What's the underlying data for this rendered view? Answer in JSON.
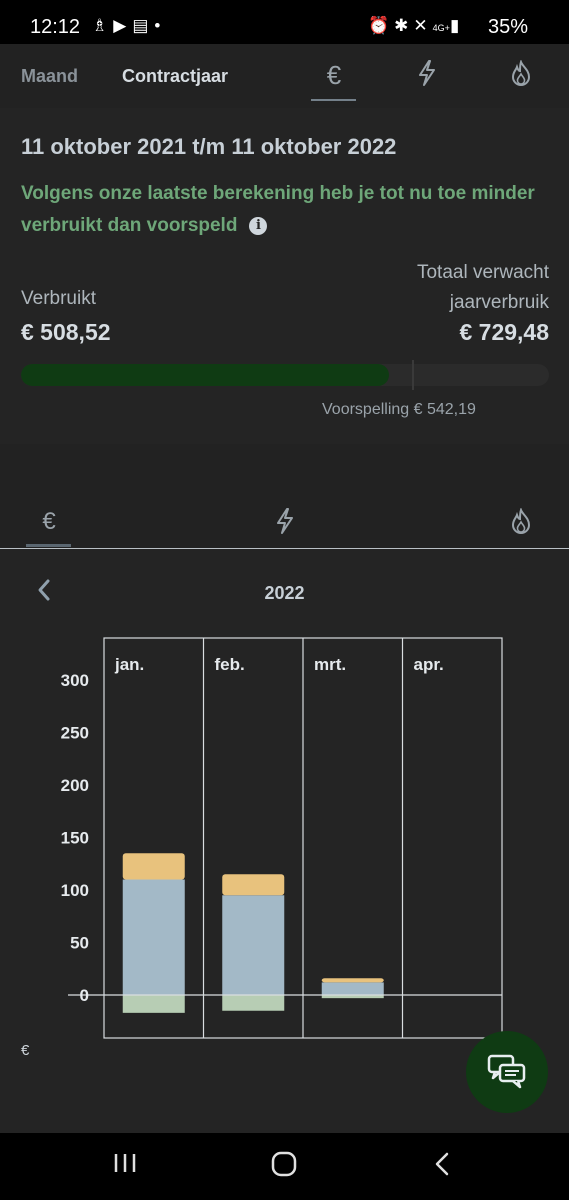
{
  "status_bar": {
    "time": "12:12",
    "left_icons": [
      "notification-icon",
      "youtube-icon",
      "news-icon",
      "dot-icon"
    ],
    "right_icons": [
      "alarm-icon",
      "bluetooth-icon",
      "mute-icon",
      "signal-icon"
    ],
    "network": "4G+",
    "battery": "35%"
  },
  "top_tabs": {
    "month": "Maand",
    "contract_year": "Contractjaar",
    "icons": [
      "euro-icon",
      "lightning-icon",
      "flame-icon"
    ]
  },
  "summary": {
    "period": "11 oktober 2021 t/m 11 oktober 2022",
    "message": "Volgens onze laatste berekening heb je tot nu toe minder verbruikt dan voorspeld",
    "used_label": "Verbruikt",
    "used_value": "€ 508,52",
    "expected_label_line1": "Totaal verwacht",
    "expected_label_line2": "jaarverbruik",
    "expected_value": "€ 729,48",
    "progress_fraction": 0.697,
    "forecast_fraction": 0.743,
    "forecast_text": "Voorspelling € 542,19"
  },
  "chart_tabs": {
    "icons": [
      "euro-icon",
      "lightning-icon",
      "flame-icon"
    ]
  },
  "chart_header": {
    "year": "2022"
  },
  "chart_data": {
    "type": "bar",
    "stacked": true,
    "categories": [
      "jan.",
      "feb.",
      "mrt.",
      "apr."
    ],
    "ylabel": "€",
    "ylim": [
      -20,
      330
    ],
    "yticks": [
      0,
      50,
      100,
      150,
      200,
      250,
      300
    ],
    "series": [
      {
        "values": [
          110,
          95,
          12,
          0
        ],
        "color": "#a3b9c7"
      },
      {
        "values": [
          25,
          20,
          4,
          0
        ],
        "color": "#e8c27d"
      },
      {
        "values": [
          -17,
          -15,
          -3,
          0
        ],
        "color": "#b7cdb4"
      }
    ]
  },
  "chat_button": {
    "icon": "chat-icon"
  },
  "navbar": {
    "items": [
      "recent-apps-icon",
      "home-icon",
      "back-icon"
    ]
  }
}
